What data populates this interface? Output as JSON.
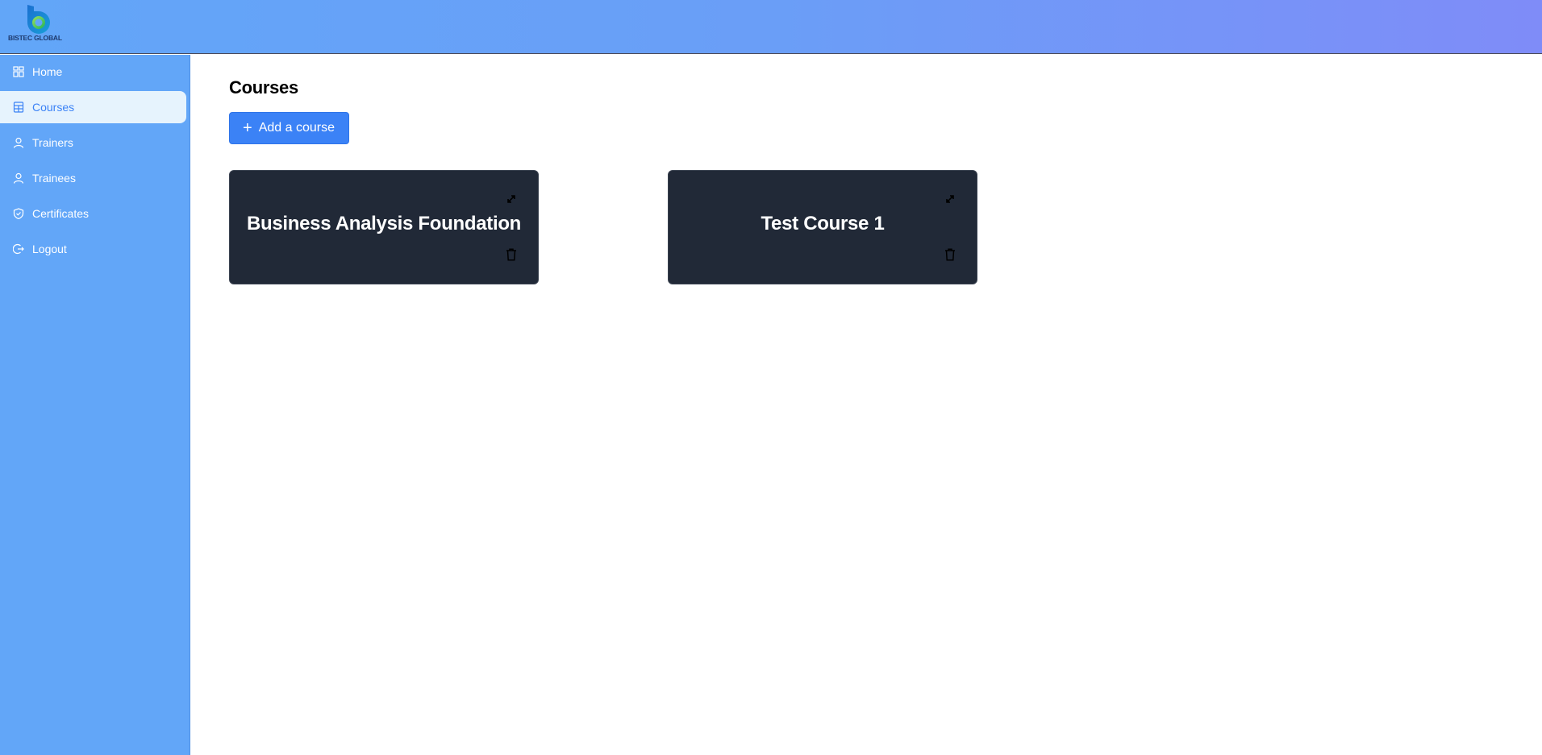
{
  "header": {
    "logo_text": "BISTEC GLOBAL"
  },
  "sidebar": {
    "items": [
      {
        "label": "Home",
        "icon": "grid-icon",
        "active": false
      },
      {
        "label": "Courses",
        "icon": "calculator-icon",
        "active": true
      },
      {
        "label": "Trainers",
        "icon": "user-icon",
        "active": false
      },
      {
        "label": "Trainees",
        "icon": "user-icon",
        "active": false
      },
      {
        "label": "Certificates",
        "icon": "shield-check-icon",
        "active": false
      },
      {
        "label": "Logout",
        "icon": "logout-icon",
        "active": false
      }
    ]
  },
  "main": {
    "title": "Courses",
    "add_button_label": "Add a course",
    "courses": [
      {
        "title": "Business Analysis Foundation"
      },
      {
        "title": "Test Course 1"
      }
    ]
  },
  "colors": {
    "sidebar_bg": "#62a6f8",
    "active_item_bg": "#e6f3fd",
    "accent": "#3b82f6",
    "card_bg": "#212937"
  }
}
